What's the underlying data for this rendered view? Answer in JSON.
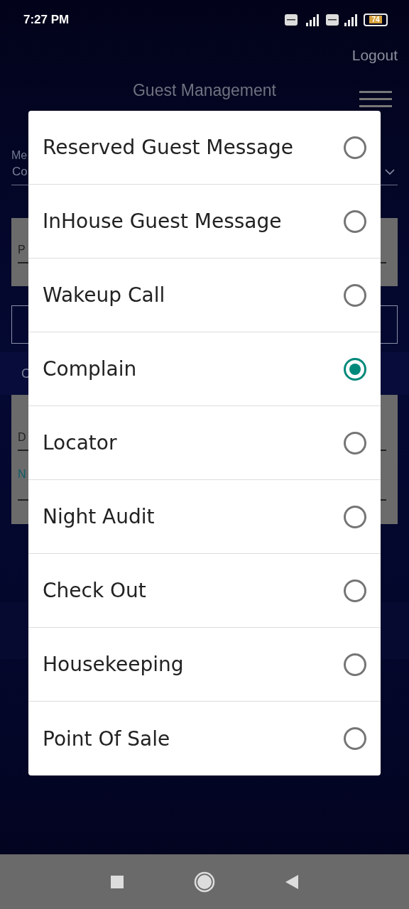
{
  "status_bar": {
    "time": "7:27 PM",
    "battery": "74"
  },
  "header": {
    "logout": "Logout",
    "title": "Guest Management"
  },
  "background_form": {
    "field_label": "Me",
    "field_value": "Co",
    "panel_1_text": "P",
    "section_text": "C",
    "panel_2_text_1": "D",
    "panel_2_text_2": "N"
  },
  "dialog": {
    "options": [
      {
        "label": "Reserved Guest Message",
        "selected": false
      },
      {
        "label": "InHouse Guest Message",
        "selected": false
      },
      {
        "label": "Wakeup Call",
        "selected": false
      },
      {
        "label": "Complain",
        "selected": true
      },
      {
        "label": "Locator",
        "selected": false
      },
      {
        "label": "Night Audit",
        "selected": false
      },
      {
        "label": "Check Out",
        "selected": false
      },
      {
        "label": "Housekeeping",
        "selected": false
      },
      {
        "label": "Point Of Sale",
        "selected": false
      }
    ]
  }
}
